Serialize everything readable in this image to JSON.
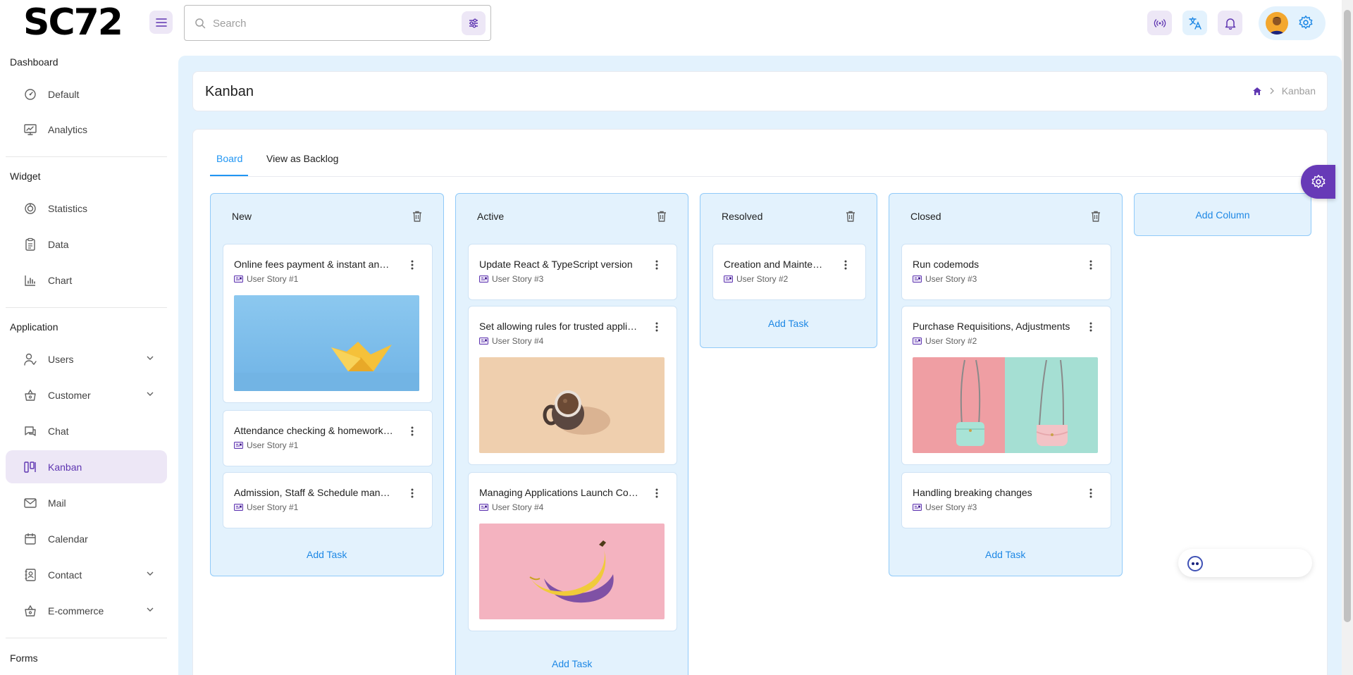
{
  "header": {
    "logo": "SC72",
    "search_placeholder": "Search",
    "icons": [
      "menu-icon",
      "search-icon",
      "filter-icon",
      "broadcast-icon",
      "translate-icon",
      "bell-icon",
      "avatar",
      "gear-icon"
    ]
  },
  "sidebar": {
    "groups": [
      {
        "title": "Dashboard",
        "items": [
          {
            "label": "Default"
          },
          {
            "label": "Analytics"
          }
        ]
      },
      {
        "title": "Widget",
        "items": [
          {
            "label": "Statistics"
          },
          {
            "label": "Data"
          },
          {
            "label": "Chart"
          }
        ]
      },
      {
        "title": "Application",
        "items": [
          {
            "label": "Users"
          },
          {
            "label": "Customer"
          },
          {
            "label": "Chat"
          },
          {
            "label": "Kanban"
          },
          {
            "label": "Mail"
          },
          {
            "label": "Calendar"
          },
          {
            "label": "Contact"
          },
          {
            "label": "E-commerce"
          }
        ]
      },
      {
        "title": "Forms",
        "items": []
      }
    ],
    "active": "Kanban"
  },
  "page": {
    "title": "Kanban",
    "breadcrumb": "Kanban"
  },
  "tabs": [
    {
      "label": "Board"
    },
    {
      "label": "View as Backlog"
    }
  ],
  "columns": [
    {
      "title": "New",
      "add_label": "Add Task",
      "tasks": [
        {
          "title": "Online fees payment & instant announcements",
          "story": "User Story #1"
        },
        {
          "title": "Attendance checking & homework details",
          "story": "User Story #1"
        },
        {
          "title": "Admission, Staff & Schedule management",
          "story": "User Story #1"
        }
      ]
    },
    {
      "title": "Active",
      "add_label": "Add Task",
      "tasks": [
        {
          "title": "Update React & TypeScript version",
          "story": "User Story #3"
        },
        {
          "title": "Set allowing rules for trusted applications",
          "story": "User Story #4"
        },
        {
          "title": "Managing Applications Launch Control",
          "story": "User Story #4"
        }
      ]
    },
    {
      "title": "Resolved",
      "add_label": "Add Task",
      "tasks": [
        {
          "title": "Creation and Maintenance",
          "story": "User Story #2"
        }
      ]
    },
    {
      "title": "Closed",
      "add_label": "Add Task",
      "tasks": [
        {
          "title": "Run codemods",
          "story": "User Story #3"
        },
        {
          "title": "Purchase Requisitions, Adjustments",
          "story": "User Story #2"
        },
        {
          "title": "Handling breaking changes",
          "story": "User Story #3"
        }
      ]
    }
  ],
  "add_column_label": "Add Column",
  "colors": {
    "accent": "#673ab7",
    "primary": "#2196f3",
    "column_bg": "#e3f2fd"
  }
}
